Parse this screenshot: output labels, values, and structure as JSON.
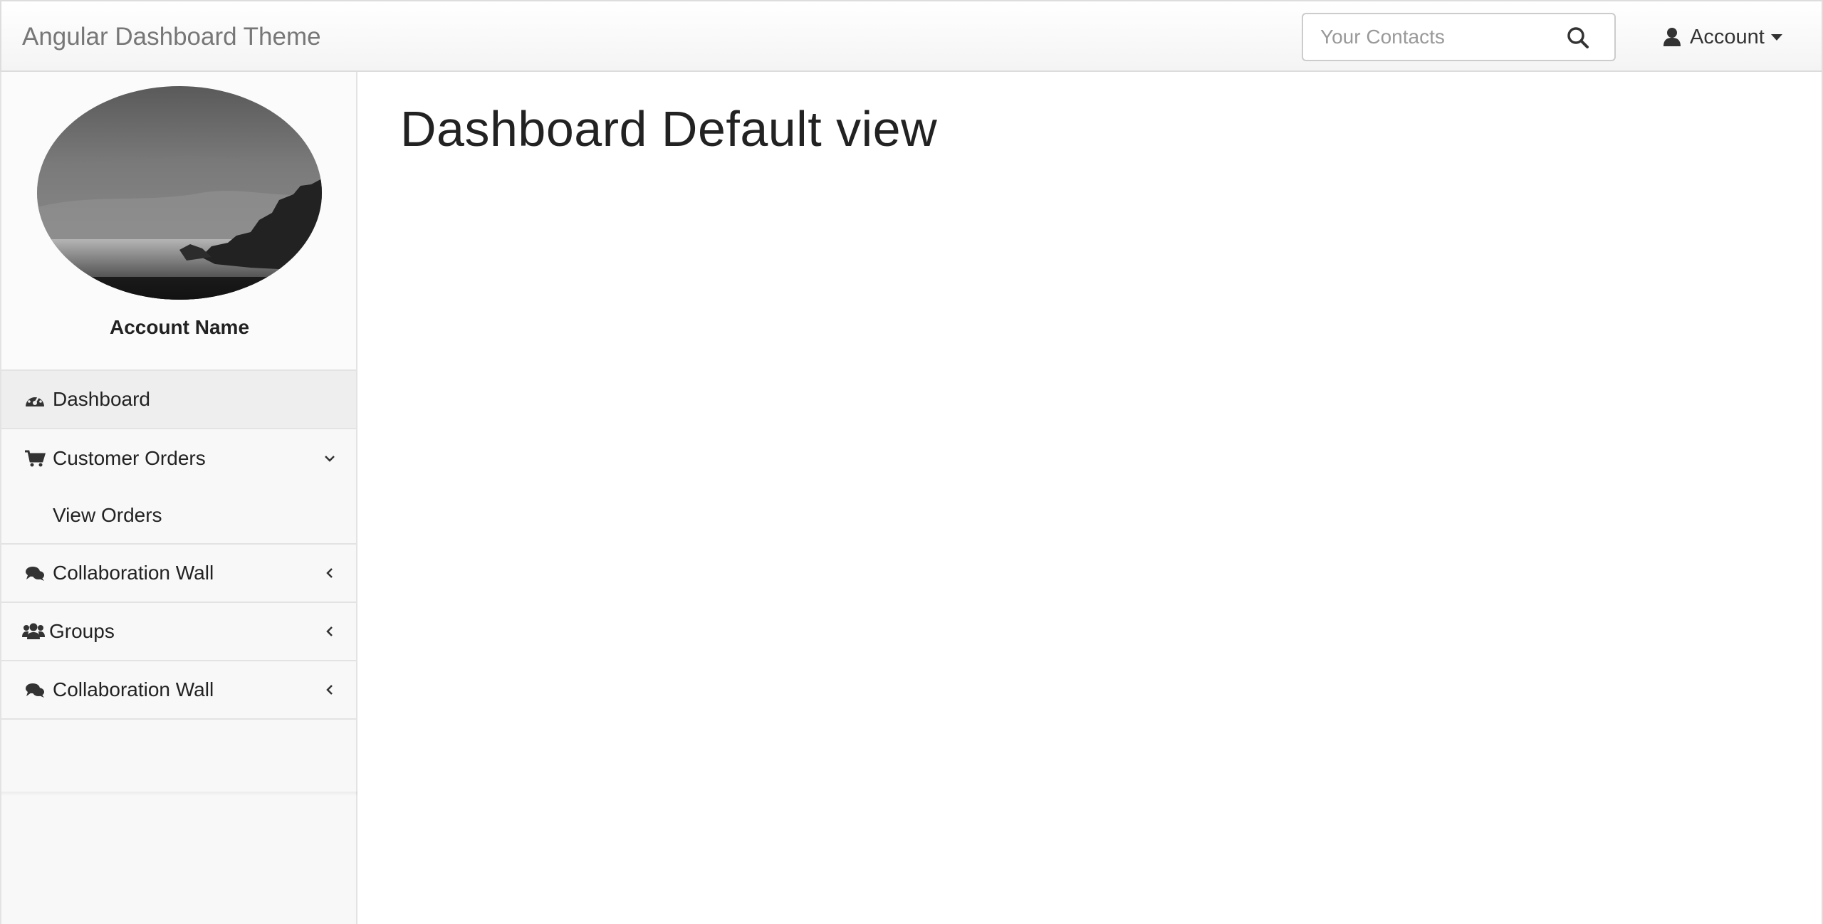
{
  "header": {
    "brand": "Angular Dashboard Theme",
    "search_placeholder": "Your Contacts",
    "search_icon": "search-icon",
    "account_label": "Account",
    "account_icon": "user-icon"
  },
  "sidebar": {
    "account_name": "Account Name",
    "items": [
      {
        "label": "Dashboard",
        "icon": "dashboard-gauge-icon",
        "active": true
      },
      {
        "label": "Customer Orders",
        "icon": "shopping-cart-icon",
        "expanded": true,
        "children": [
          {
            "label": "View Orders"
          }
        ]
      },
      {
        "label": "Collaboration Wall",
        "icon": "comments-icon"
      },
      {
        "label": "Groups",
        "icon": "users-icon"
      },
      {
        "label": "Collaboration Wall",
        "icon": "comments-icon"
      }
    ]
  },
  "main": {
    "title": "Dashboard Default view"
  }
}
